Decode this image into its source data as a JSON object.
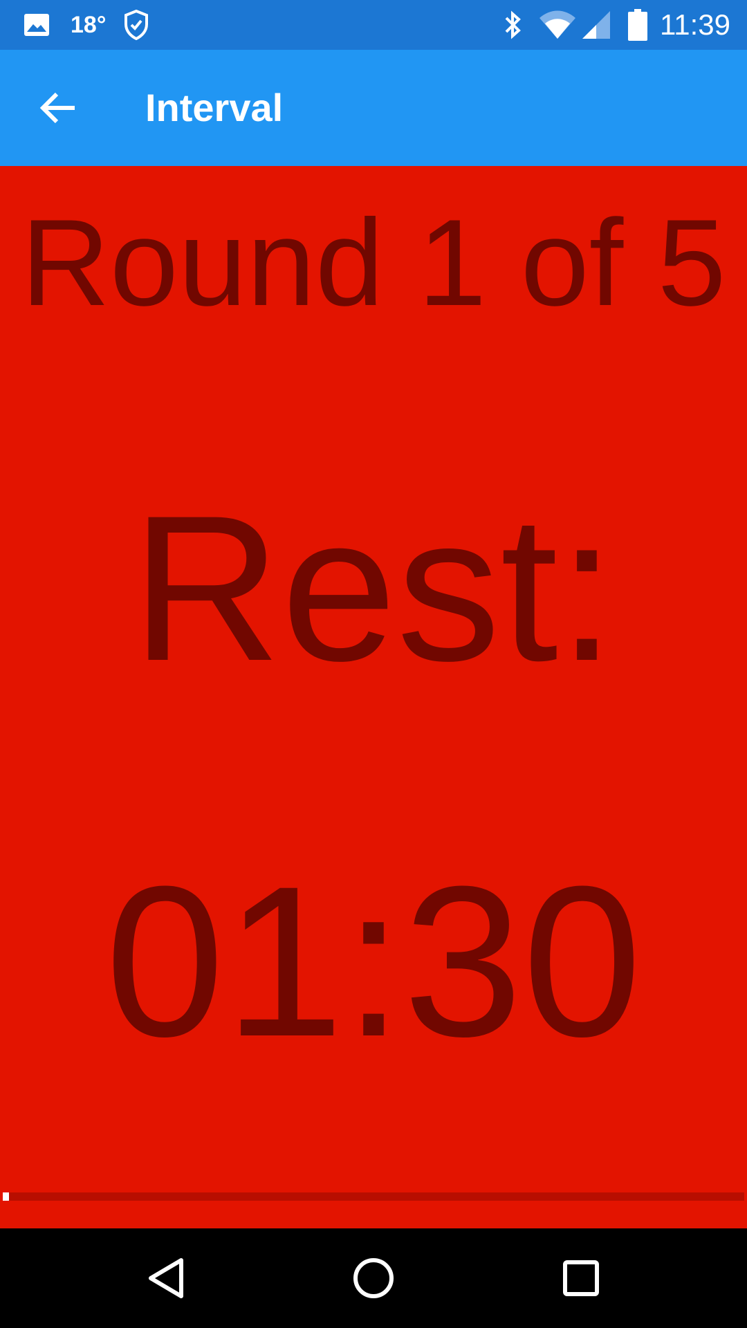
{
  "status_bar": {
    "temperature": "18°",
    "time": "11:39",
    "icons": [
      "image-icon",
      "shield-check-icon",
      "bluetooth-icon",
      "wifi-icon",
      "cell-signal-icon",
      "battery-icon"
    ]
  },
  "app_bar": {
    "title": "Interval",
    "back_icon": "arrow-left-icon"
  },
  "main": {
    "round_text": "Round 1 of 5",
    "phase_text": "Rest:",
    "timer_text": "01:30",
    "progress_fraction": 0.008
  },
  "nav_bar": {
    "icons": [
      "nav-back-icon",
      "nav-home-icon",
      "nav-recents-icon"
    ]
  },
  "colors": {
    "status_bar": "#1c77d3",
    "app_bar": "#2196f3",
    "background": "#e31400",
    "text": "#710700",
    "progress_track": "#b80e00",
    "progress_fill": "#ffffff"
  }
}
